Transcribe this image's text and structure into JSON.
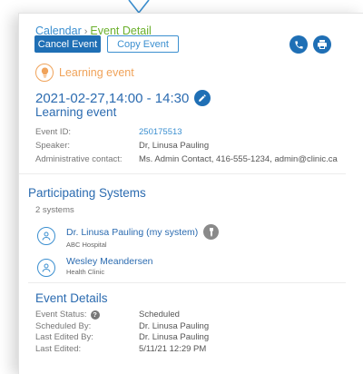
{
  "breadcrumb": {
    "root": "Calendar",
    "separator": "›",
    "current": "Event Detail"
  },
  "actions": {
    "cancel_label": "Cancel Event",
    "copy_label": "Copy Event"
  },
  "icons": {
    "phone": "phone-icon",
    "print": "print-icon",
    "event_type": "lightbulb-icon",
    "edit": "pencil-icon",
    "system": "user-circle-icon",
    "badge": "tag-icon"
  },
  "event": {
    "type_label": "Learning event",
    "datetime": "2021-02-27,14:00 - 14:30",
    "title": "Learning event",
    "fields": [
      {
        "label": "Event ID:",
        "value": "250175513"
      },
      {
        "label": "Speaker:",
        "value": "Dr, Linusa Pauling"
      },
      {
        "label": "Administrative contact:",
        "value": "Ms. Admin Contact, 416-555-1234, admin@clinic.ca"
      }
    ]
  },
  "participating": {
    "title": "Participating Systems",
    "count": "2 systems",
    "systems": [
      {
        "name": "Dr. Linusa Pauling (my system)",
        "org": "ABC Hospital"
      },
      {
        "name": "Wesley Meandersen",
        "org": "Health Clinic"
      }
    ]
  },
  "details": {
    "title": "Event Details",
    "fields": [
      {
        "label": "Event Status:",
        "value": "Scheduled"
      },
      {
        "label": "Scheduled By:",
        "value": "Dr. Linusa Pauling"
      },
      {
        "label": "Last Edited By:",
        "value": "Dr. Linusa Pauling"
      },
      {
        "label": "Last Edited:",
        "value": "5/11/21 12:29 PM"
      }
    ]
  },
  "colors": {
    "primary": "#1f6fb5",
    "link": "#3b8fd0",
    "breadcrumb_current": "#6bb02c",
    "event_type": "#f0a35a"
  }
}
